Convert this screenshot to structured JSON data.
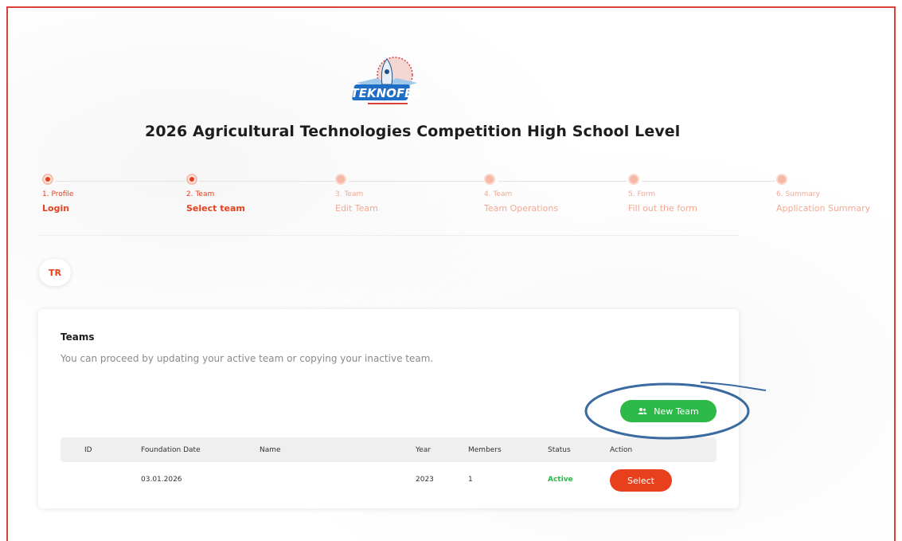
{
  "page": {
    "title": "2026 Agricultural Technologies Competition High School Level"
  },
  "logo": {
    "text": "TEKNOFEST"
  },
  "stepper": {
    "steps": [
      {
        "number_label": "1. Profile",
        "name": "Login",
        "state": "completed"
      },
      {
        "number_label": "2. Team",
        "name": "Select team",
        "state": "current"
      },
      {
        "number_label": "3. Team",
        "name": "Edit Team",
        "state": "future"
      },
      {
        "number_label": "4. Team",
        "name": "Team Operations",
        "state": "future"
      },
      {
        "number_label": "5. Form",
        "name": "Fill out the form",
        "state": "future"
      },
      {
        "number_label": "6. Summary",
        "name": "Application Summary",
        "state": "future"
      }
    ]
  },
  "language": {
    "code": "TR"
  },
  "teams": {
    "title": "Teams",
    "subtitle": "You can proceed by updating your active team or copying your inactive team.",
    "new_team_label": "New Team",
    "new_team_icon": "users-icon",
    "columns": [
      "ID",
      "Foundation Date",
      "Name",
      "Year",
      "Members",
      "Status",
      "Action"
    ],
    "rows": [
      {
        "id": "",
        "foundation_date": "03.01.2026",
        "name": "",
        "year": "2023",
        "members": "1",
        "status": "Active",
        "action": "Select"
      }
    ]
  },
  "colors": {
    "accent": "#e8401c",
    "success": "#2cb94a",
    "frame": "#d9413b",
    "annotation": "#3a6aa0"
  }
}
